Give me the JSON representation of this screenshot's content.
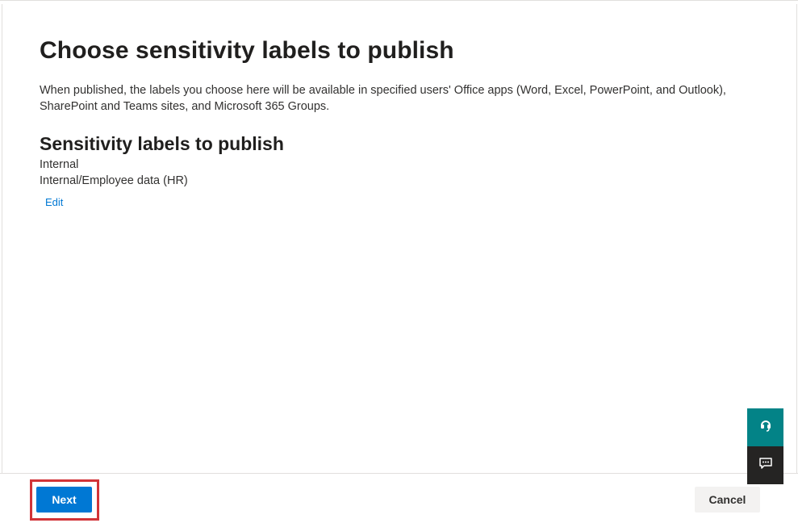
{
  "page": {
    "title": "Choose sensitivity labels to publish",
    "description": "When published, the labels you choose here will be available in specified users' Office apps (Word, Excel, PowerPoint, and Outlook), SharePoint and Teams sites, and Microsoft 365 Groups."
  },
  "section": {
    "title": "Sensitivity labels to publish",
    "labels": [
      "Internal",
      "Internal/Employee data (HR)"
    ],
    "edit_label": "Edit"
  },
  "footer": {
    "next_label": "Next",
    "cancel_label": "Cancel"
  },
  "floating_actions": {
    "help_icon": "headset-icon",
    "feedback_icon": "feedback-icon"
  },
  "colors": {
    "primary": "#0078d4",
    "highlight": "#d13438",
    "help_bg": "#038387",
    "feedback_bg": "#252423"
  }
}
